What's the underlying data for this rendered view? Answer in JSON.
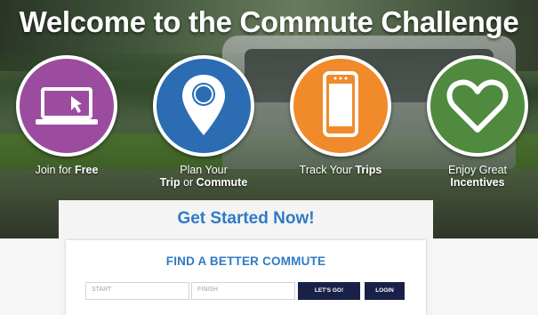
{
  "hero": {
    "headline": "Welcome to the Commute Challenge"
  },
  "features": [
    {
      "icon": "laptop-icon",
      "color": "#9b4c9f",
      "line1_pre": "Join for ",
      "line1_bold": "Free",
      "line2_pre": "",
      "line2_bold": "",
      "line2_mid": "",
      "line2_bold2": ""
    },
    {
      "icon": "map-pin-icon",
      "color": "#2b6cb3",
      "line1_pre": "Plan Your",
      "line1_bold": "",
      "line2_pre": "",
      "line2_bold": "Trip",
      "line2_mid": " or ",
      "line2_bold2": "Commute"
    },
    {
      "icon": "smartphone-icon",
      "color": "#f18a2a",
      "line1_pre": "Track Your ",
      "line1_bold": "Trips",
      "line2_pre": "",
      "line2_bold": "",
      "line2_mid": "",
      "line2_bold2": ""
    },
    {
      "icon": "heart-icon",
      "color": "#4f8a3f",
      "line1_pre": "Enjoy Great",
      "line1_bold": "",
      "line2_pre": "",
      "line2_bold": "Incentives",
      "line2_mid": "",
      "line2_bold2": ""
    }
  ],
  "panel": {
    "title": "Get Started Now!"
  },
  "form": {
    "heading": "FIND A BETTER COMMUTE",
    "start_placeholder": "START",
    "finish_placeholder": "FINISH",
    "go_label": "LET'S GO!",
    "login_label": "LOGIN"
  }
}
